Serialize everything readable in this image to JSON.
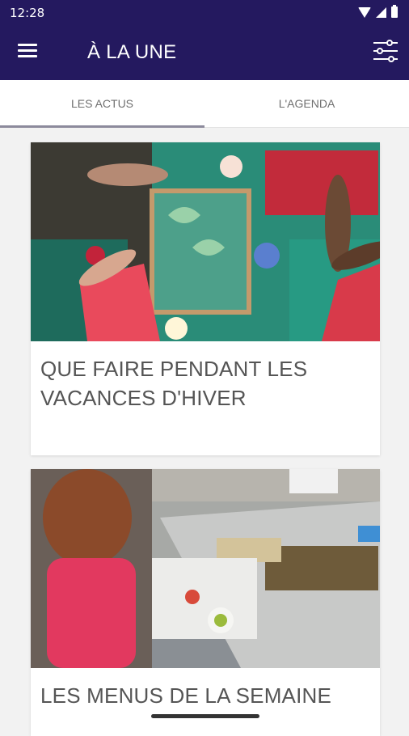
{
  "status_bar": {
    "time": "12:28"
  },
  "app_bar": {
    "title": "À LA UNE"
  },
  "tabs": [
    {
      "label": "LES ACTUS",
      "selected": true
    },
    {
      "label": "L'AGENDA",
      "selected": false
    }
  ],
  "articles": [
    {
      "title": "QUE FAIRE PENDANT LES VACANCES D'HIVER",
      "image": "paper-crafts-photo"
    },
    {
      "title": "LES MENUS DE LA SEMAINE",
      "image": "school-cafeteria-photo"
    }
  ],
  "colors": {
    "app_bar": "#24195f",
    "tab_indicator": "#8c8a9c",
    "background": "#f2f2f2"
  }
}
